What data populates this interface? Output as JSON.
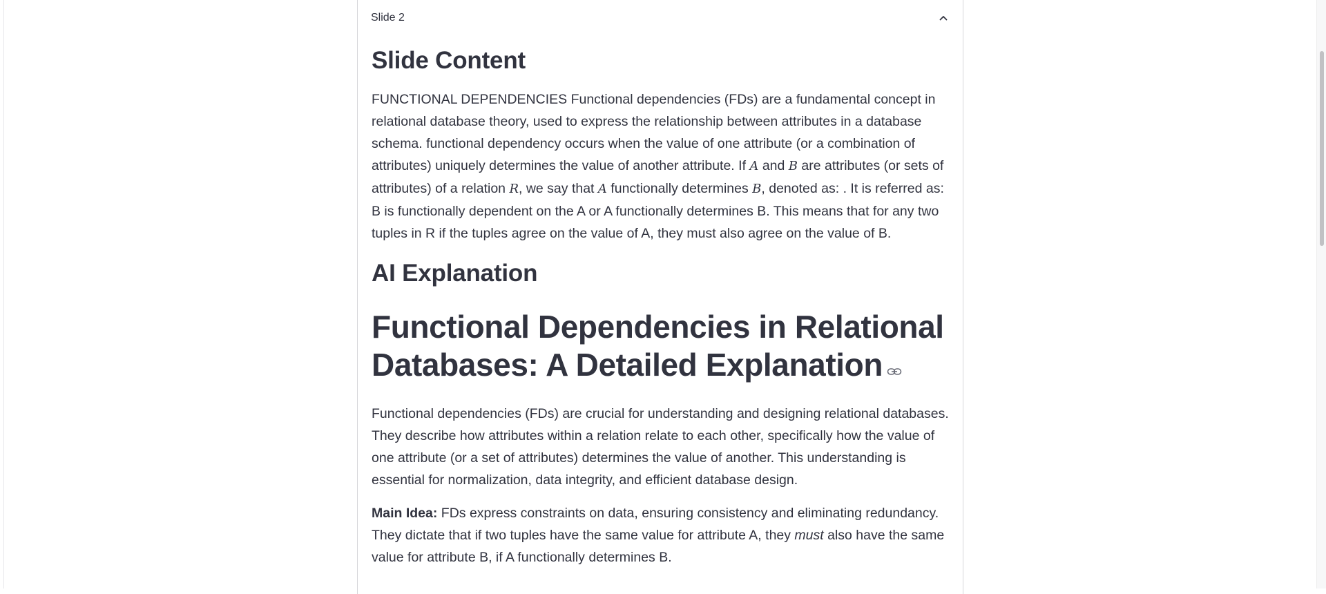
{
  "expander": {
    "title": "Slide 2",
    "icon": "chevron-up-icon"
  },
  "slide_content": {
    "heading": "Slide Content",
    "p1": "FUNCTIONAL DEPENDENCIES Functional dependencies (FDs) are a fundamental concept in relational database theory, used to express the relationship between attributes in a database schema. functional dependency occurs when the value of one attribute (or a combination of attributes) uniquely determines the value of another attribute. If ",
    "var_a": "A",
    "p2": " and ",
    "var_b": "B",
    "p3": " are attributes (or sets of attributes) of a relation ",
    "var_r": "R",
    "p4": ", we say that ",
    "var_a2": "A",
    "p5": " functionally determines ",
    "var_b2": "B",
    "p6": ", denoted as: . It is referred as: B is functionally dependent on the A or A functionally determines B. This means that for any two tuples in R if the tuples agree on the value of A, they must also agree on the value of B."
  },
  "ai_explanation": {
    "heading": "AI Explanation",
    "title": "Functional Dependencies in Relational Databases: A Detailed Explanation",
    "anchor_icon": "link-icon",
    "intro": "Functional dependencies (FDs) are crucial for understanding and designing relational databases. They describe how attributes within a relation relate to each other, specifically how the value of one attribute (or a set of attributes) determines the value of another. This understanding is essential for normalization, data integrity, and efficient database design.",
    "main_idea_label": "Main Idea:",
    "main_idea_a": " FDs express constraints on data, ensuring consistency and eliminating redundancy. They dictate that if two tuples have the same value for attribute A, they ",
    "main_idea_em": "must",
    "main_idea_b": " also have the same value for attribute B, if A functionally determines B."
  },
  "scrollbar": {
    "position_fraction": 0.09
  }
}
